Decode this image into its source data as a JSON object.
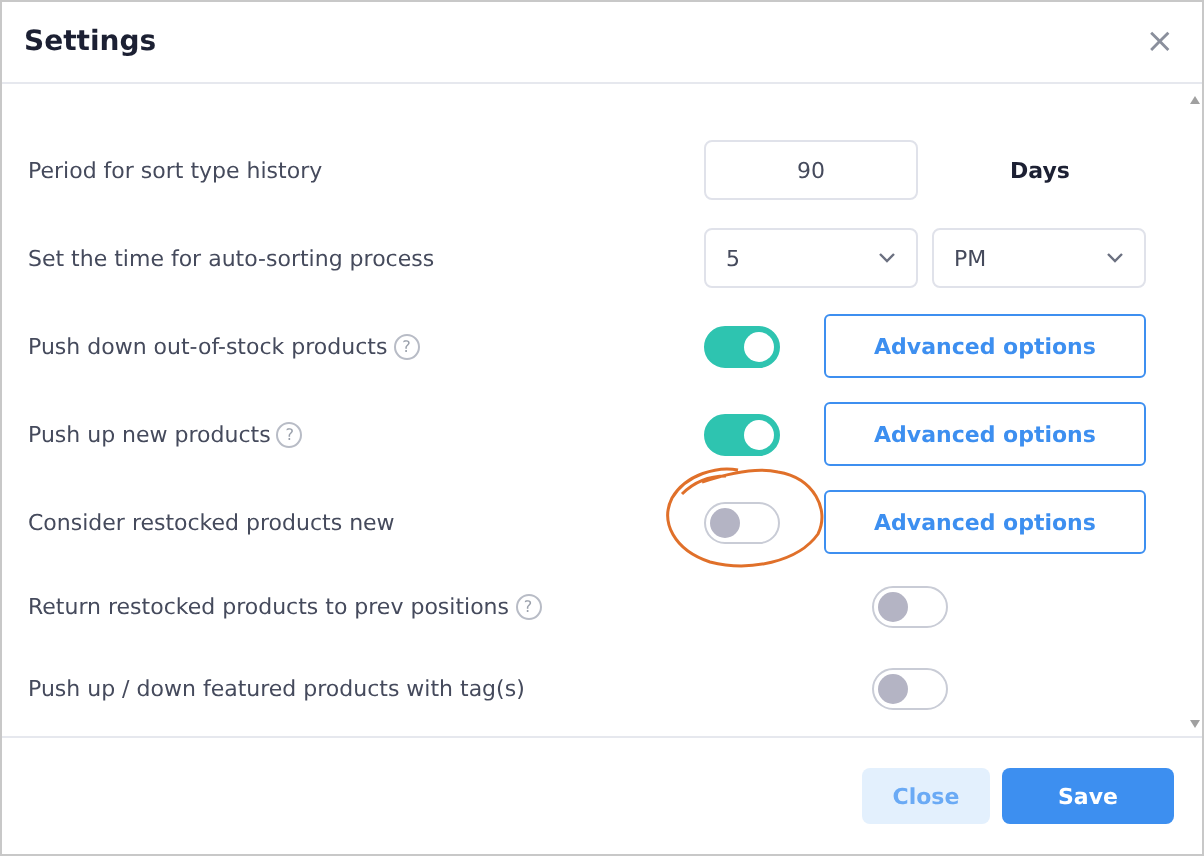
{
  "dialog": {
    "title": "Settings",
    "close": "×"
  },
  "rows": [
    {
      "kind": "number",
      "label": "Period for sort type history",
      "value": "90",
      "unit": "Days"
    },
    {
      "kind": "time",
      "label": "Set the time for auto-sorting process",
      "hour": "5",
      "period": "PM"
    },
    {
      "kind": "toggle",
      "label": "Push down out-of-stock products",
      "help": "?",
      "on": true,
      "advanced": "Advanced options",
      "annotated": false
    },
    {
      "kind": "toggle",
      "label": "Push up new products",
      "help": "?",
      "on": true,
      "advanced": "Advanced options",
      "annotated": false
    },
    {
      "kind": "toggle",
      "label": "Consider restocked products new",
      "on": false,
      "advanced": "Advanced options",
      "annotated": true
    },
    {
      "kind": "toggle",
      "label": "Return restocked products to prev positions",
      "help": "?",
      "on": false,
      "annotated": false
    },
    {
      "kind": "toggle",
      "label": "Push up / down featured products with tag(s)",
      "on": false,
      "annotated": false
    }
  ],
  "buttons": [
    {
      "label": "Close",
      "kind": "secondary"
    },
    {
      "label": "Save",
      "kind": "primary"
    }
  ]
}
